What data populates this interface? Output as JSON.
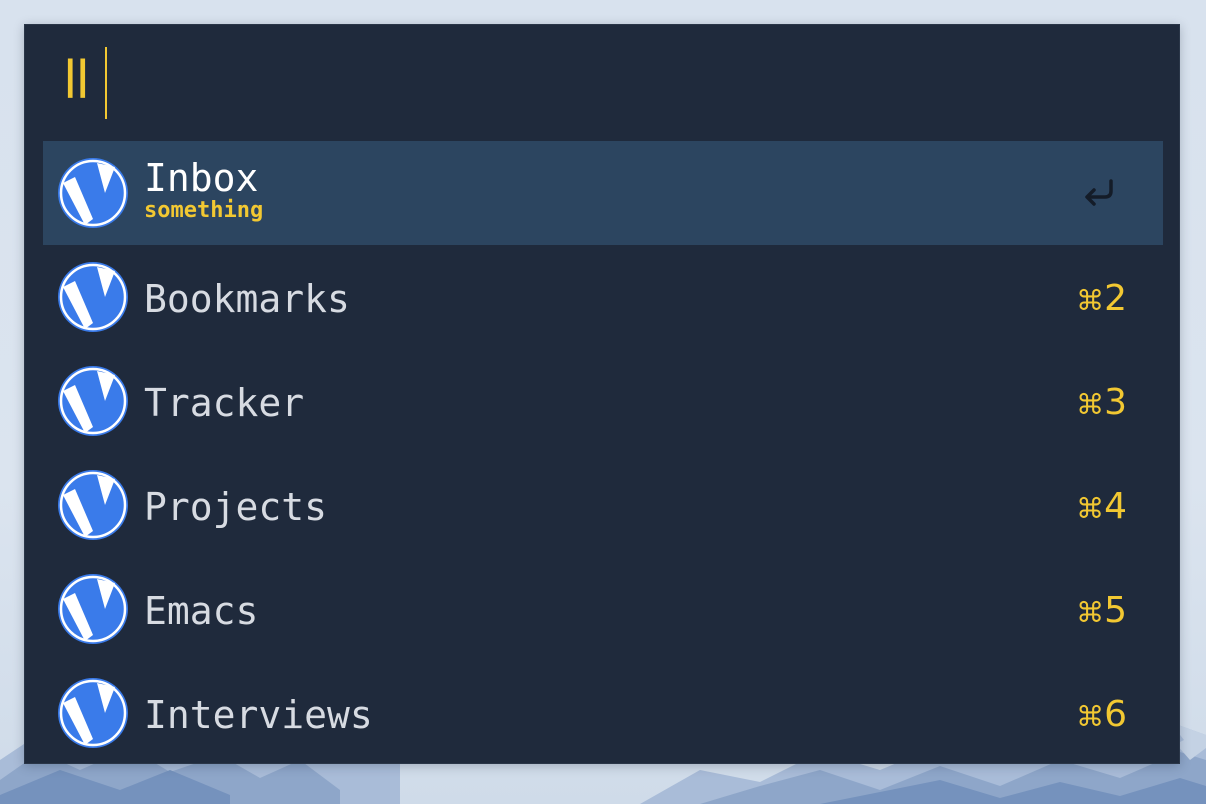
{
  "search": {
    "query": "ll"
  },
  "results": [
    {
      "title": "Inbox",
      "subtitle": "something",
      "selected": true,
      "icon": "vivaldi-icon",
      "action_icon": "return-icon"
    },
    {
      "title": "Bookmarks",
      "shortcut_symbol": "⌘",
      "shortcut_key": "2",
      "icon": "vivaldi-icon"
    },
    {
      "title": "Tracker",
      "shortcut_symbol": "⌘",
      "shortcut_key": "3",
      "icon": "vivaldi-icon"
    },
    {
      "title": "Projects",
      "shortcut_symbol": "⌘",
      "shortcut_key": "4",
      "icon": "vivaldi-icon"
    },
    {
      "title": "Emacs",
      "shortcut_symbol": "⌘",
      "shortcut_key": "5",
      "icon": "vivaldi-icon"
    },
    {
      "title": "Interviews",
      "shortcut_symbol": "⌘",
      "shortcut_key": "6",
      "icon": "vivaldi-icon"
    }
  ],
  "colors": {
    "panel_bg": "#1f2a3c",
    "selected_bg": "#2c4560",
    "accent": "#f2c832",
    "icon_blue": "#3a7bea"
  }
}
